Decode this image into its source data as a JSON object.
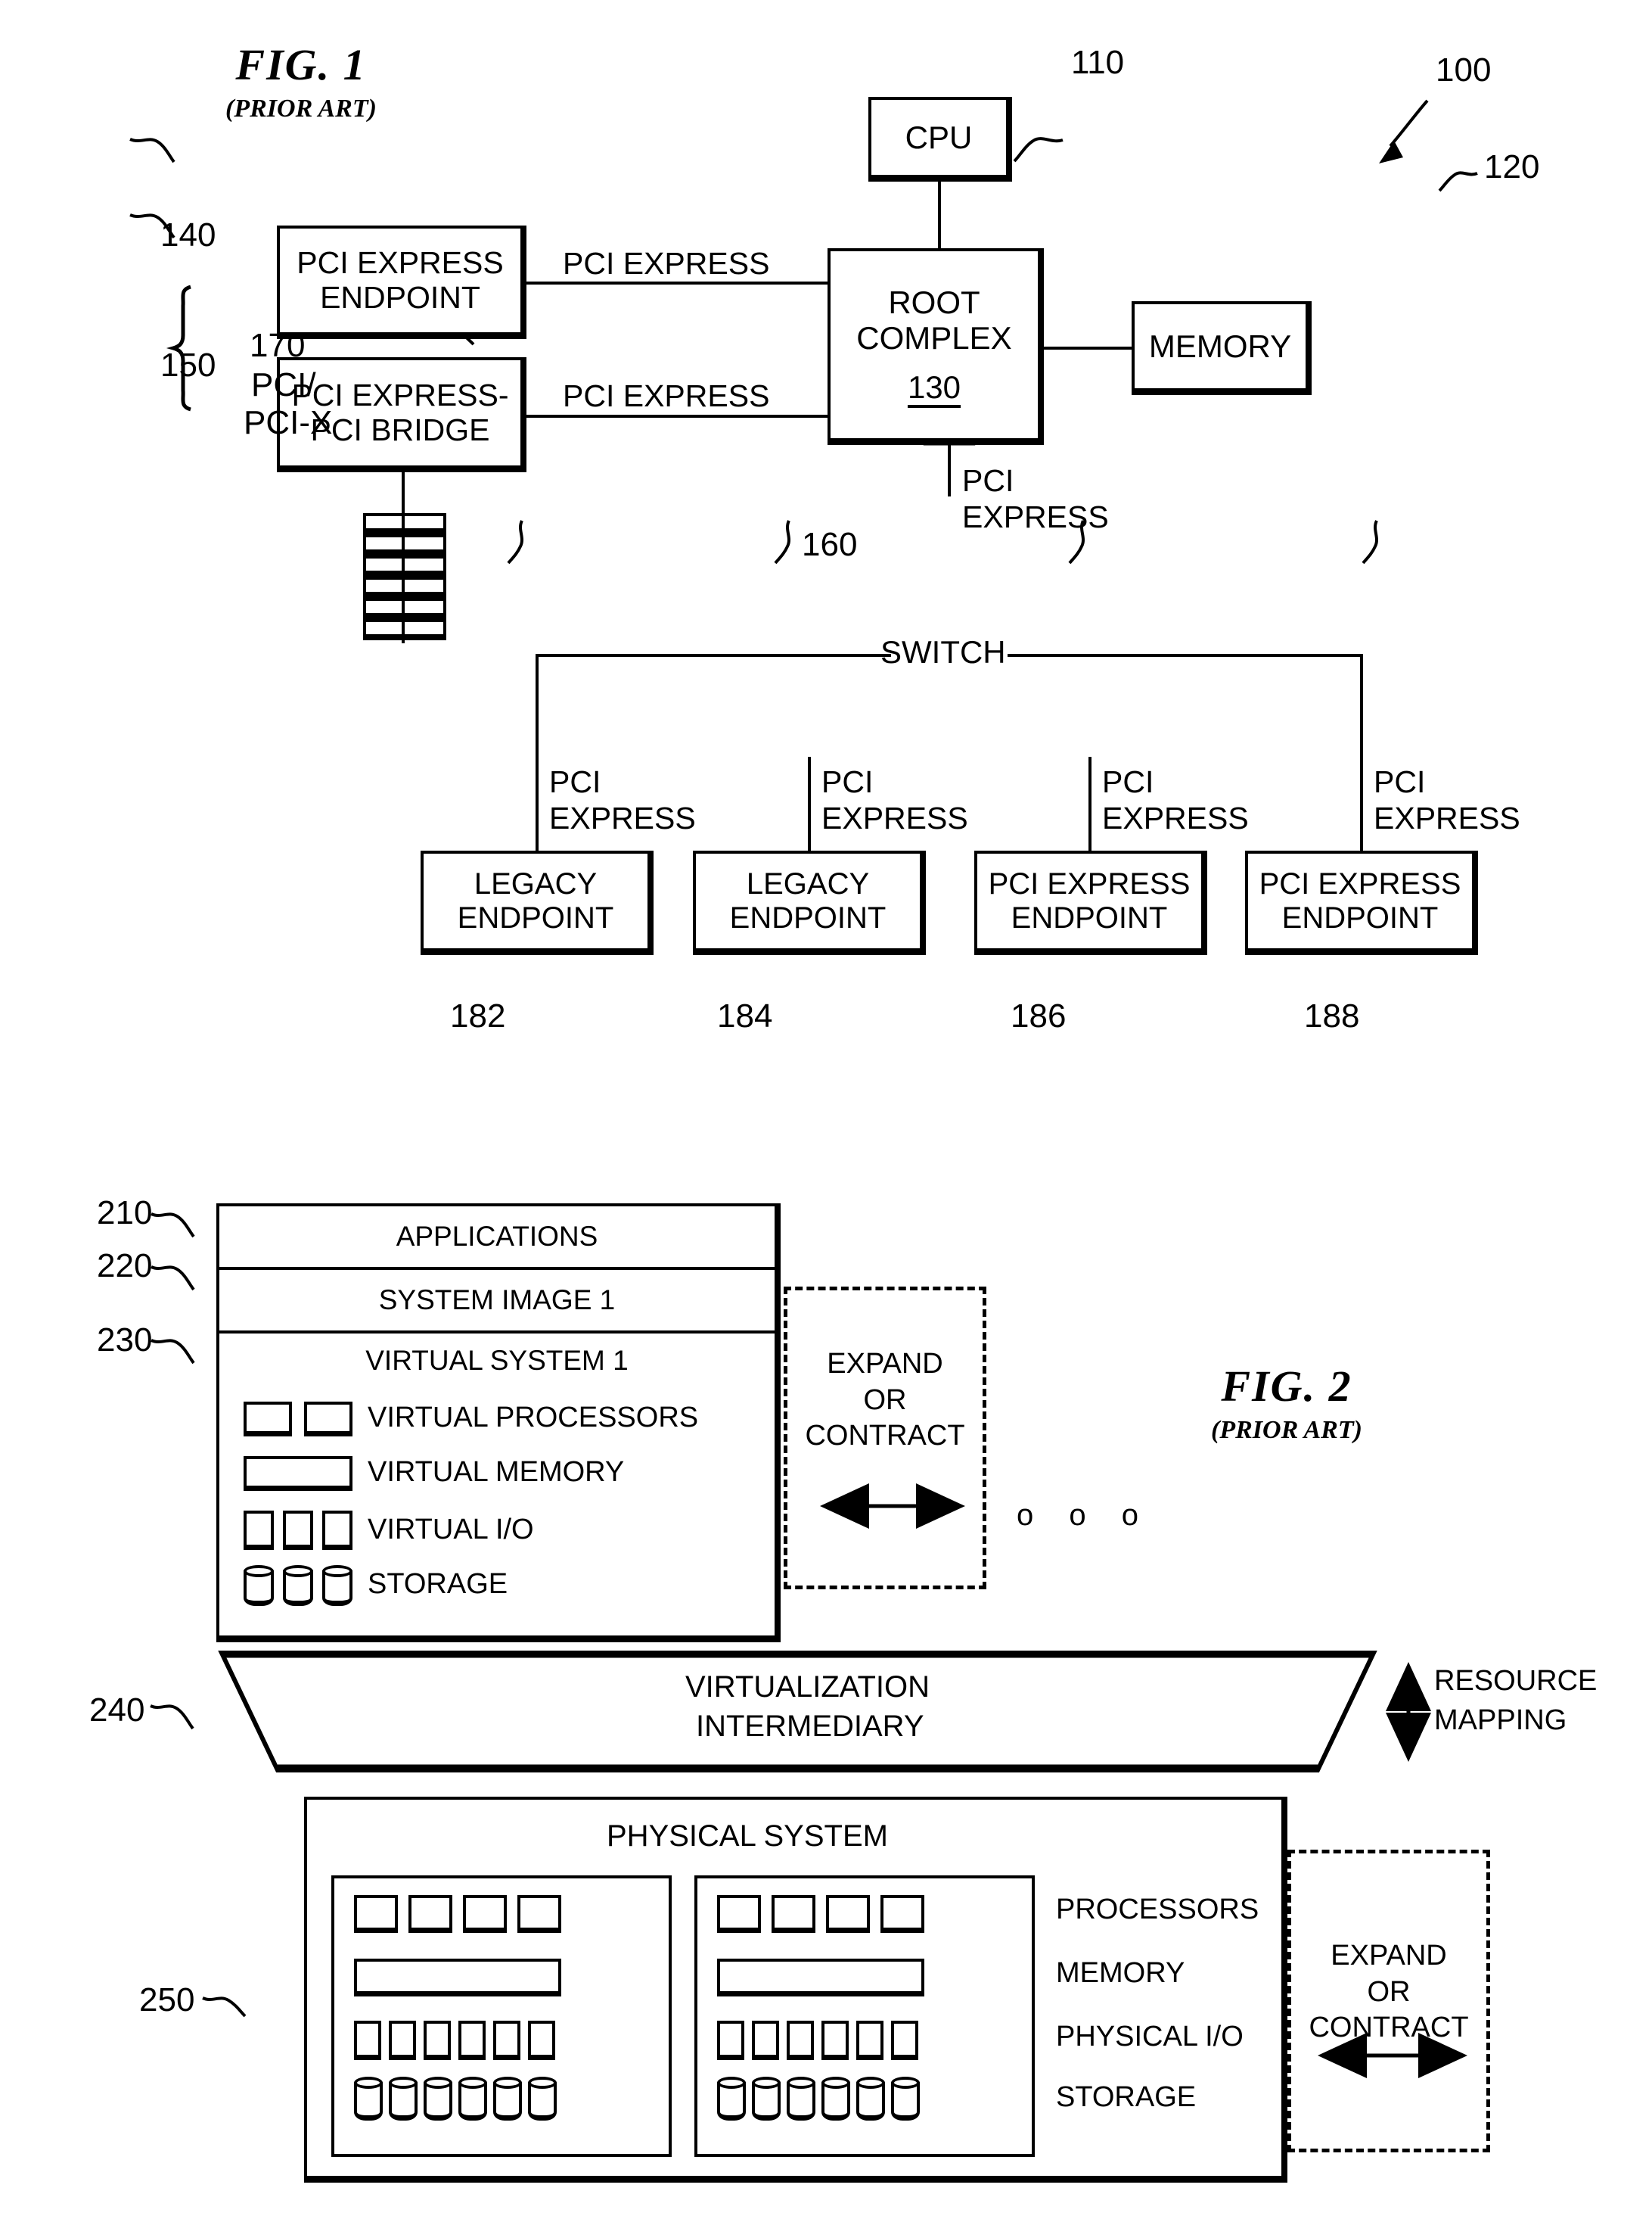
{
  "figure1": {
    "title": "FIG. 1",
    "subtitle": "(PRIOR ART)",
    "system_ref": "100",
    "nodes": {
      "cpu": {
        "label": "CPU",
        "ref": "110"
      },
      "memory": {
        "label": "MEMORY",
        "ref": "120"
      },
      "root_complex": {
        "line1": "ROOT",
        "line2": "COMPLEX",
        "ref": "130"
      },
      "endpoint_140": {
        "line1": "PCI EXPRESS",
        "line2": "ENDPOINT",
        "ref": "140"
      },
      "bridge_150": {
        "line1": "PCI EXPRESS-",
        "line2": "PCI BRIDGE",
        "ref": "150"
      },
      "switch": {
        "label": "SWITCH",
        "ref": "160"
      },
      "slots_170": {
        "ref": "170",
        "line1": "PCI/",
        "line2": "PCI-X",
        "count": 6
      }
    },
    "link_labels": {
      "endpoint_link": "PCI EXPRESS",
      "bridge_link": "PCI EXPRESS",
      "root_to_switch_l1": "PCI",
      "root_to_switch_l2": "EXPRESS",
      "branch_l1": "PCI",
      "branch_l2": "EXPRESS"
    },
    "endpoints": [
      {
        "line1": "LEGACY",
        "line2": "ENDPOINT",
        "ref": "182"
      },
      {
        "line1": "LEGACY",
        "line2": "ENDPOINT",
        "ref": "184"
      },
      {
        "line1": "PCI EXPRESS",
        "line2": "ENDPOINT",
        "ref": "186"
      },
      {
        "line1": "PCI EXPRESS",
        "line2": "ENDPOINT",
        "ref": "188"
      }
    ]
  },
  "figure2": {
    "title": "FIG. 2",
    "subtitle": "(PRIOR ART)",
    "stack": {
      "applications": {
        "label": "APPLICATIONS",
        "ref": "210"
      },
      "system_image": {
        "label": "SYSTEM IMAGE 1",
        "ref": "220"
      },
      "virtual_system": {
        "label": "VIRTUAL SYSTEM 1",
        "ref": "230"
      }
    },
    "virtual_resources": [
      {
        "name": "VIRTUAL PROCESSORS",
        "glyph": "processor",
        "count": 2
      },
      {
        "name": "VIRTUAL MEMORY",
        "glyph": "memory",
        "count": 1
      },
      {
        "name": "VIRTUAL I/O",
        "glyph": "io",
        "count": 3
      },
      {
        "name": "STORAGE",
        "glyph": "storage",
        "count": 3
      }
    ],
    "expand_contract_top": {
      "l1": "EXPAND",
      "l2": "OR",
      "l3": "CONTRACT"
    },
    "more_systems_ellipsis": "o  o  o",
    "virtualization_intermediary": {
      "line1": "VIRTUALIZATION",
      "line2": "INTERMEDIARY",
      "ref": "240"
    },
    "resource_mapping": {
      "line1": "RESOURCE",
      "line2": "MAPPING"
    },
    "physical_system": {
      "label": "PHYSICAL SYSTEM",
      "ref": "250"
    },
    "physical_resources": [
      {
        "name": "PROCESSORS",
        "glyph": "processor",
        "count": 4
      },
      {
        "name": "MEMORY",
        "glyph": "memory",
        "count": 1
      },
      {
        "name": "PHYSICAL I/O",
        "glyph": "io",
        "count": 6
      },
      {
        "name": "STORAGE",
        "glyph": "storage",
        "count": 6
      }
    ],
    "physical_panels": 2,
    "expand_contract_bottom": {
      "l1": "EXPAND",
      "l2": "OR",
      "l3": "CONTRACT"
    }
  },
  "colors": {
    "ink": "#000000",
    "paper": "#ffffff"
  }
}
